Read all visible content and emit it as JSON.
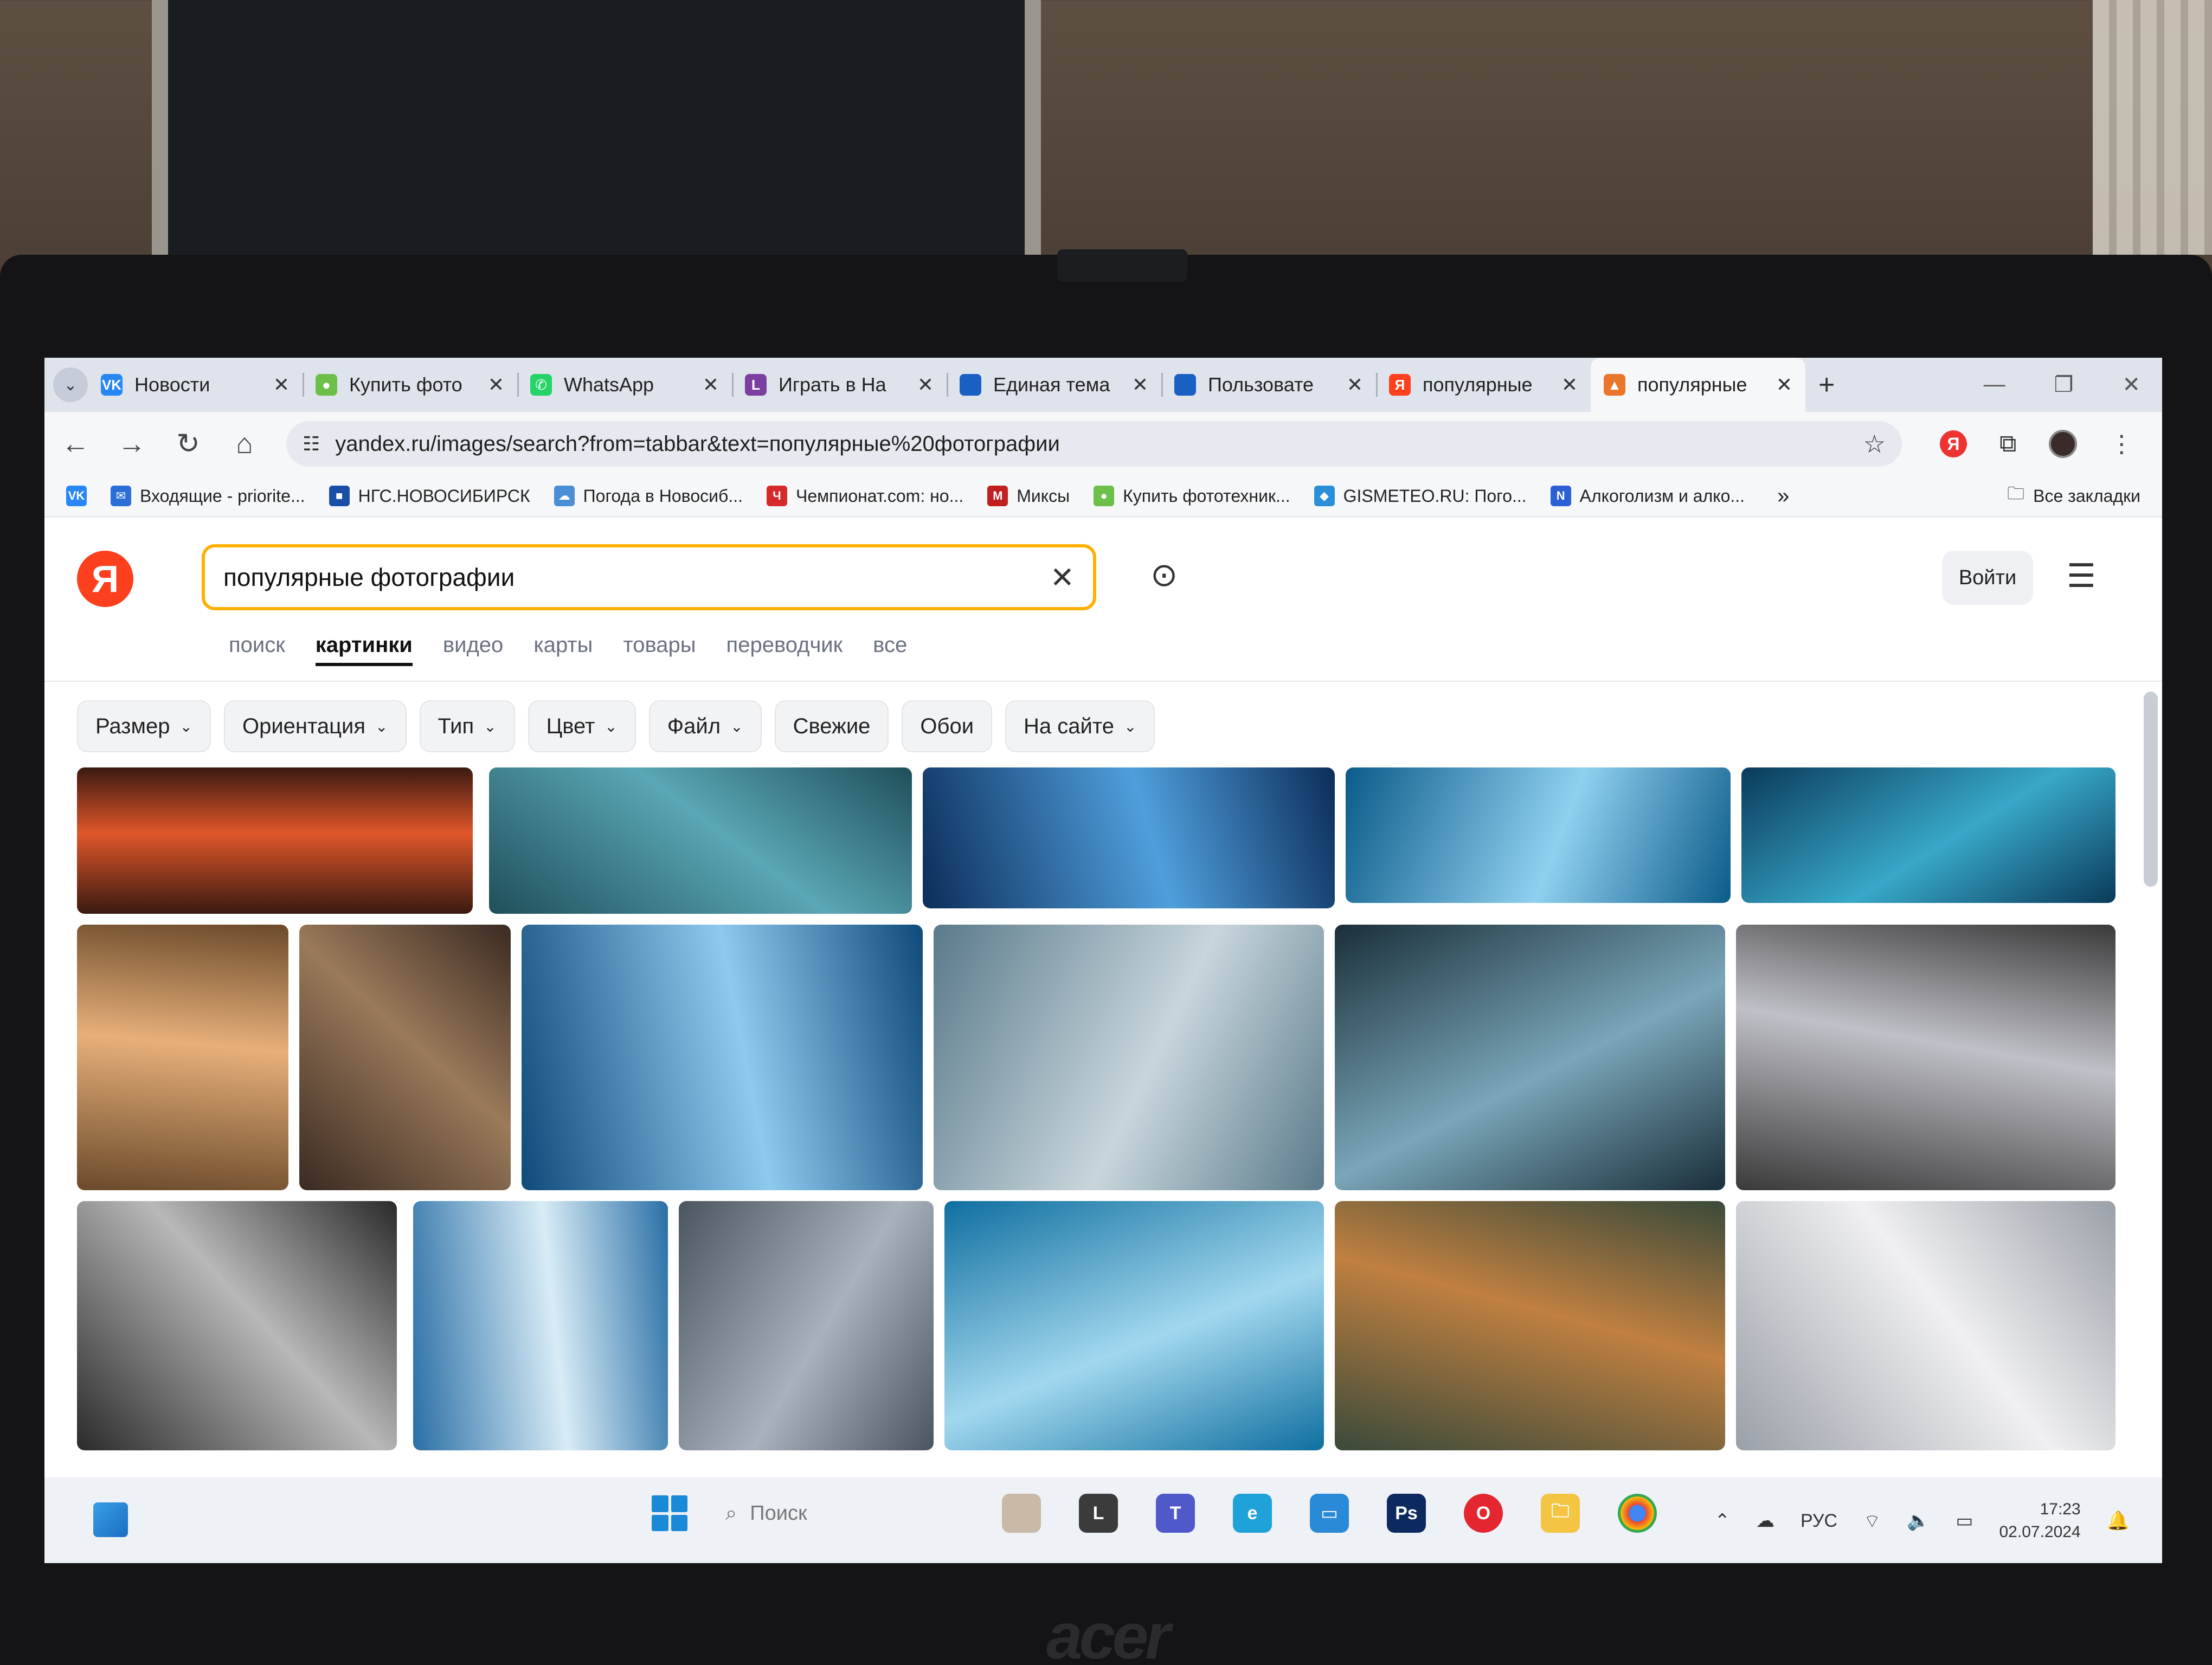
{
  "browser": {
    "tabs": [
      {
        "label": "Новости",
        "icon": "vk-icon",
        "color": "#2787f5",
        "glyph": "VK",
        "active": false
      },
      {
        "label": "Купить фото",
        "icon": "shop-icon",
        "color": "#6cc04a",
        "glyph": "●",
        "active": false
      },
      {
        "label": "WhatsApp",
        "icon": "whatsapp-icon",
        "color": "#25d366",
        "glyph": "✆",
        "active": false
      },
      {
        "label": "Играть в На",
        "icon": "game-icon",
        "color": "#7b3fa0",
        "glyph": "L",
        "active": false
      },
      {
        "label": "Единая тема",
        "icon": "doc-icon",
        "color": "#1a5fc2",
        "glyph": "",
        "active": false
      },
      {
        "label": "Пользовате",
        "icon": "doc-icon",
        "color": "#1a5fc2",
        "glyph": "",
        "active": false
      },
      {
        "label": "популярные",
        "icon": "yandex-icon",
        "color": "#fc3f1d",
        "glyph": "Я",
        "active": false
      },
      {
        "label": "популярные",
        "icon": "images-icon",
        "color": "#e8762b",
        "glyph": "▲",
        "active": true
      }
    ],
    "new_tab": "+",
    "url": "yandex.ru/images/search?from=tabbar&text=популярные%20фотографии",
    "bookmarks": [
      {
        "label": "Входящие - priorite...",
        "color": "#2a6fd6",
        "glyph": "✉"
      },
      {
        "label": "НГС.НОВОСИБИРСК",
        "color": "#1a4fa8",
        "glyph": "■"
      },
      {
        "label": "Погода в Новосиб...",
        "color": "#4a8fd6",
        "glyph": "☁"
      },
      {
        "label": "Чемпионат.com: но...",
        "color": "#d62a2a",
        "glyph": "Ч"
      },
      {
        "label": "Миксы",
        "color": "#c02020",
        "glyph": "M"
      },
      {
        "label": "Купить фототехник...",
        "color": "#6cc04a",
        "glyph": "●"
      },
      {
        "label": "GISMETEO.RU: Пого...",
        "color": "#2a8fd6",
        "glyph": "◆"
      },
      {
        "label": "Алкоголизм и алко...",
        "color": "#2a5fd6",
        "glyph": "N"
      }
    ],
    "bookmarks_more": "»",
    "all_bookmarks": "Все закладки"
  },
  "page": {
    "logo": "Я",
    "search_value": "популярные фотографии",
    "login": "Войти",
    "services": [
      "поиск",
      "картинки",
      "видео",
      "карты",
      "товары",
      "переводчик",
      "все"
    ],
    "active_service": "картинки",
    "filters": [
      {
        "label": "Размер",
        "dropdown": true
      },
      {
        "label": "Ориентация",
        "dropdown": true
      },
      {
        "label": "Тип",
        "dropdown": true
      },
      {
        "label": "Цвет",
        "dropdown": true
      },
      {
        "label": "Файл",
        "dropdown": true
      },
      {
        "label": "Свежие",
        "dropdown": false
      },
      {
        "label": "Обои",
        "dropdown": false
      },
      {
        "label": "На сайте",
        "dropdown": true
      }
    ],
    "thumbnails": [
      "city-night-thumbnail",
      "mountain-lake-thumbnail",
      "city-skyline-thumbnail",
      "surfing-wave-thumbnail",
      "lake-reflection-thumbnail",
      "girl-with-dog-thumbnail",
      "canyon-river-thumbnail",
      "dog-in-water-thumbnail",
      "underwater-bear-thumbnail",
      "ice-cave-boat-thumbnail",
      "couple-mountains-thumbnail",
      "woman-with-dog-bw-thumbnail",
      "wave-photographer-thumbnail",
      "child-portrait-thumbnail",
      "frozen-lake-thumbnail",
      "misty-mountains-thumbnail",
      "man-with-husky-thumbnail"
    ]
  },
  "taskbar": {
    "search_placeholder": "Поиск",
    "language": "РУС",
    "time": "17:23",
    "date": "02.07.2024"
  },
  "device": {
    "brand": "acer"
  }
}
